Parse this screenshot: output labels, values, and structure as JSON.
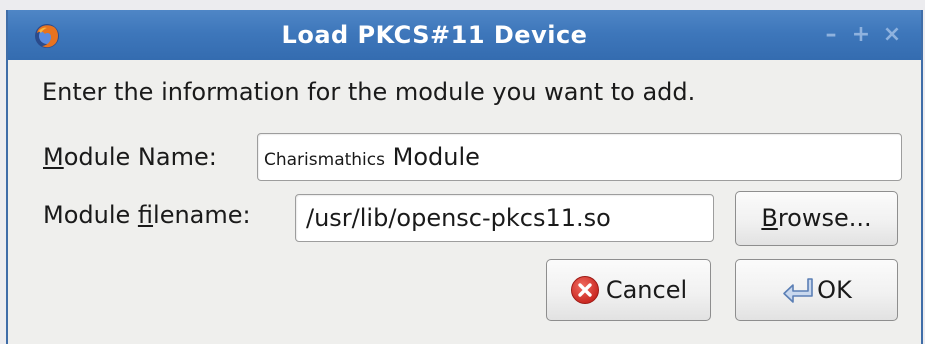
{
  "window": {
    "title": "Load PKCS#11 Device",
    "controls": {
      "minimize": "–",
      "maximize": "+",
      "close": "×"
    }
  },
  "intro_text": "Enter the information for the module you want to add.",
  "module_name": {
    "label_mnemonic": "M",
    "label_rest": "odule Name:",
    "value_small": "Charismathics",
    "value_large": " Module"
  },
  "module_filename": {
    "label_before": "Module ",
    "label_mnemonic": "f",
    "label_rest": "ilename:",
    "value": "/usr/lib/opensc-pkcs11.so"
  },
  "buttons": {
    "browse_mnemonic": "B",
    "browse_rest": "rowse...",
    "cancel": "Cancel",
    "ok": "OK"
  },
  "icons": {
    "app": "firefox-icon",
    "cancel": "cancel-icon",
    "ok": "ok-arrow-icon"
  },
  "colors": {
    "titlebar": "#3e77bb",
    "cancel_icon": "#d9302b"
  }
}
